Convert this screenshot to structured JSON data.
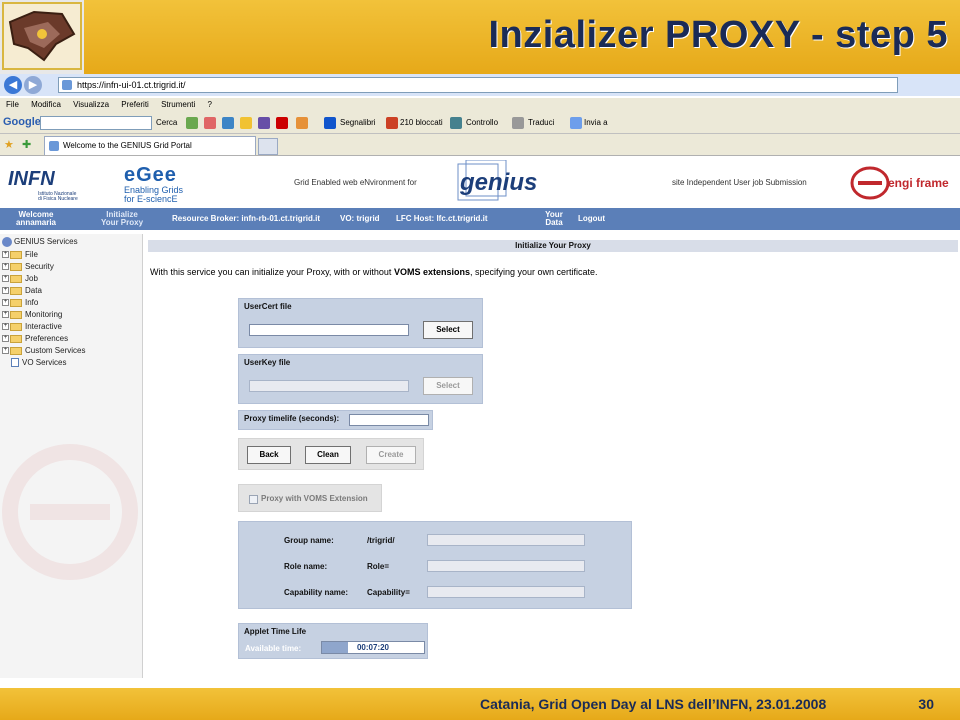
{
  "slide": {
    "title": "Inzializer PROXY -  step 5",
    "footer": "Catania, Grid Open Day al LNS dell’INFN, 23.01.2008",
    "page_number": "30"
  },
  "browser": {
    "url": "https://infn-ui-01.ct.trigrid.it/",
    "menu": [
      "File",
      "Modifica",
      "Visualizza",
      "Preferiti",
      "Strumenti",
      "?"
    ],
    "toolbar": {
      "google": "Google",
      "search": "Cerca",
      "bookmarks": "Segnalibri",
      "blocked": "210 bloccati",
      "check": "Controllo",
      "translate": "Traduci",
      "send": "Invia a"
    },
    "tab_title": "Welcome to the GENIUS Grid Portal"
  },
  "banner": {
    "infn": "INFN",
    "infn_sub": [
      "Istituto Nazionale",
      "di Fisica Nucleare"
    ],
    "egee": "eGee",
    "egee_sub": [
      "Enabling Grids",
      "for E-sciencE"
    ],
    "left_text": "Grid Enabled web eNvironment for",
    "genius": "genius",
    "right_text": "site Independent User job Submission",
    "enginframe": "engi frame"
  },
  "navbar": {
    "welcome": "Welcome",
    "user": "annamaria",
    "init1": "Initialize",
    "init2": "Your Proxy",
    "broker": "Resource Broker: infn-rb-01.ct.trigrid.it",
    "vo": "VO: trigrid",
    "lfc": "LFC Host: lfc.ct.trigrid.it",
    "data1": "Your",
    "data2": "Data",
    "logout": "Logout"
  },
  "sidebar": {
    "root": "GENIUS Services",
    "items": [
      {
        "label": "File"
      },
      {
        "label": "Security"
      },
      {
        "label": "Job"
      },
      {
        "label": "Data"
      },
      {
        "label": "Info"
      },
      {
        "label": "Monitoring"
      },
      {
        "label": "Interactive"
      },
      {
        "label": "Preferences"
      },
      {
        "label": "Custom Services"
      },
      {
        "label": "VO Services"
      }
    ]
  },
  "main": {
    "section_title": "Initialize Your Proxy",
    "intro_pre": "With this service you can initialize your Proxy, with or without ",
    "intro_bold": "VOMS extensions",
    "intro_post": ", specifying your own certificate.",
    "usercert_label": "UserCert file",
    "userkey_label": "UserKey file",
    "select_label": "Select",
    "proxy_lifetime_label": "Proxy timelife (seconds):",
    "proxy_lifetime_value": "",
    "back_label": "Back",
    "clean_label": "Clean",
    "create_label": "Create",
    "voms_checkbox_label": "Proxy with VOMS Extension",
    "voms_checked": false,
    "group_label": "Group name:",
    "group_value": "/trigrid/",
    "role_label": "Role name:",
    "role_value": "Role=",
    "capability_label": "Capability name:",
    "capability_value": "Capability=",
    "applet_title": "Applet Time Life",
    "available_label": "Available time:",
    "available_time": "00:07:20"
  },
  "colors": {
    "gold": "#e6a919",
    "title_navy": "#1a2b57",
    "nav_blue": "#5b7fb8",
    "panel_blue": "#c6d1e2"
  }
}
